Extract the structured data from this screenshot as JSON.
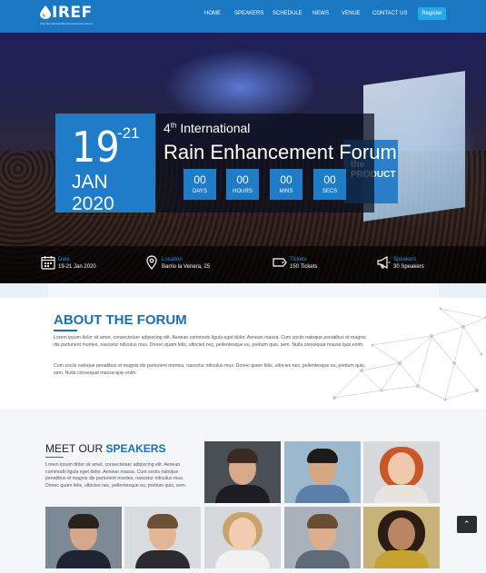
{
  "nav": {
    "logo_text": "IREF",
    "logo_sub": "The International Rain Enhancement Forum",
    "items": [
      "HOME",
      "SPEAKERS",
      "SCHEDULE",
      "NEWS",
      "VENUE",
      "CONTACT US"
    ],
    "register_label": "Register"
  },
  "hero": {
    "screen_text": "the PRODUCT",
    "date_day": "19",
    "date_day_end": "-21",
    "date_month": "JAN 2020",
    "edition": "4",
    "edition_suffix": "th",
    "edition_rest": " International",
    "title": "Rain Enhancement Forum",
    "countdown": [
      {
        "value": "00",
        "label": "DAYS"
      },
      {
        "value": "00",
        "label": "HOURS"
      },
      {
        "value": "00",
        "label": "MINS"
      },
      {
        "value": "00",
        "label": "SECS"
      }
    ],
    "info": [
      {
        "icon": "calendar-icon",
        "label": "Date",
        "value": "19-21 Jan 2020"
      },
      {
        "icon": "location-pin-icon",
        "label": "Location",
        "value": "Barrio la Venera, 25"
      },
      {
        "icon": "ticket-icon",
        "label": "Tickets",
        "value": "150 Tickets"
      },
      {
        "icon": "megaphone-icon",
        "label": "Speakers",
        "value": "30 Speakers"
      }
    ]
  },
  "about": {
    "title": "ABOUT THE FORUM",
    "p1": "Lorem ipsum dolor sit amet, consectetuer adipiscing elit. Aenean commodo ligula eget dolor. Aenean massa. Cum sociis natoque penatibus et magnis dis parturient montes, nascetur ridiculus mus. Donec quam felis, ultricies nec, pellentesque eu, pretium quis, sem. Nulla consequat massa quis enim.",
    "p2": "Cum sociis natoque penatibus et magnis dis parturient montes, nascetur ridiculus mus. Donec quam felis, ultricies nec, pellentesque eu, pretium quis, sem. Nulla consequat massa quis enim."
  },
  "speakers": {
    "title_plain": "MEET OUR ",
    "title_accent": "SPEAKERS",
    "text": "Lorem ipsum dolor sit amet, consectetuer adipiscing elit. Aenean commodo ligula eget dolor. Aenean massa. Cum sociis natoque penatibus et magnis dis parturient montes, nascetur ridiculus mus. Donec quam felis, ultricies nec, pellentesque eu, pretium quis, sem."
  },
  "colors": {
    "brand_blue": "#1e7cc8",
    "nav_blue": "#1a78c2",
    "accent_light": "#28a7e8"
  }
}
